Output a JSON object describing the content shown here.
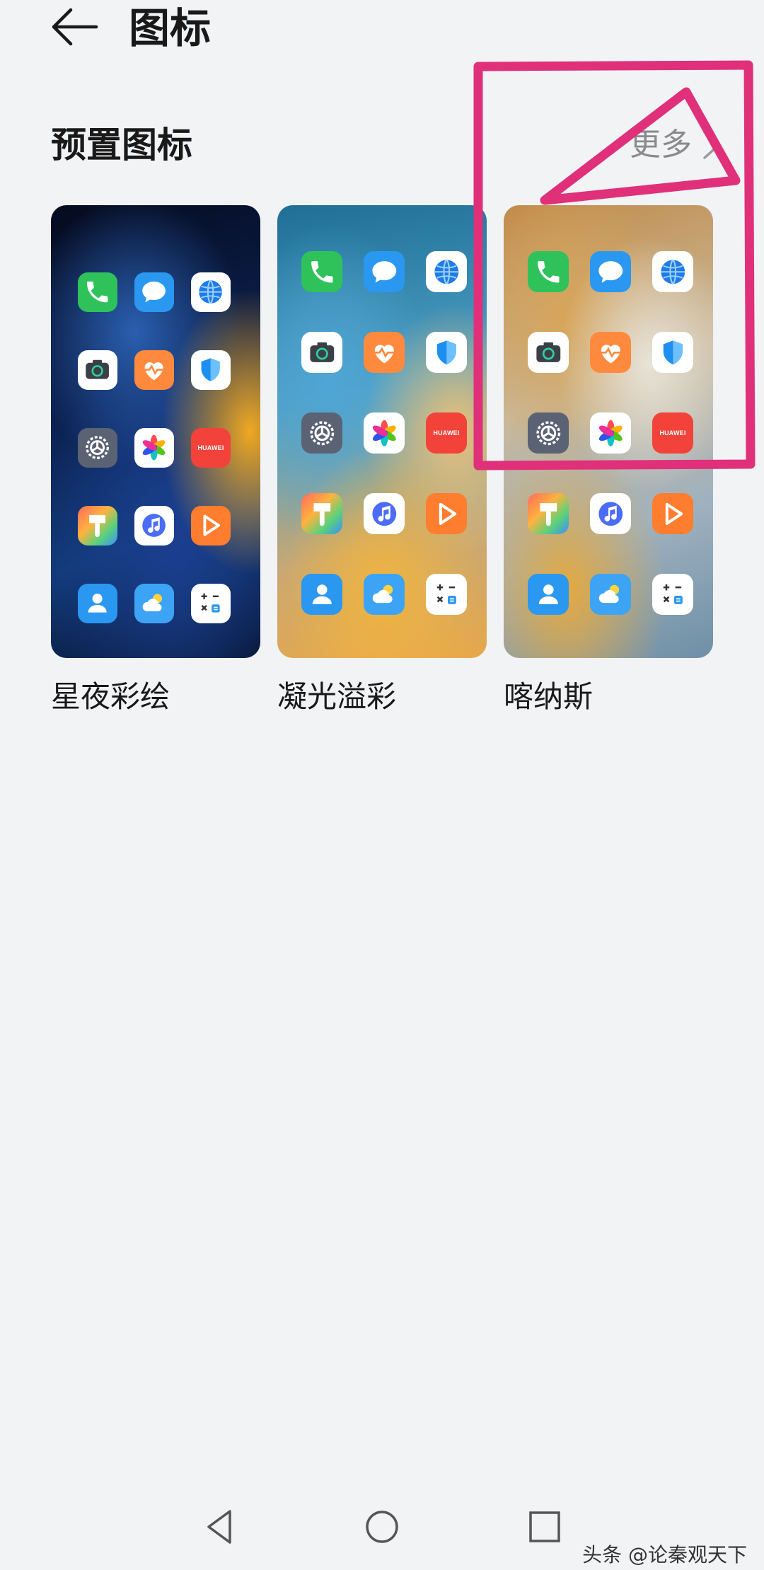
{
  "header": {
    "title": "图标",
    "back_icon": "arrow-left-icon"
  },
  "section": {
    "title": "预置图标",
    "more_label": "更多"
  },
  "cards": [
    {
      "label": "星夜彩绘"
    },
    {
      "label": "凝光溢彩"
    },
    {
      "label": "喀纳斯"
    }
  ],
  "app_icons": [
    "phone-icon",
    "messages-icon",
    "browser-icon",
    "camera-icon",
    "health-icon",
    "security-icon",
    "settings-icon",
    "gallery-icon",
    "appgallery-icon",
    "themes-icon",
    "music-icon",
    "video-icon",
    "contacts-icon",
    "weather-icon",
    "calculator-icon"
  ],
  "appgallery_text": "HUAWEI",
  "annotation_color": "#e0307a",
  "watermark": "头条 @论秦观天下",
  "nav": {
    "back_icon": "triangle-back-icon",
    "home_icon": "circle-home-icon",
    "recent_icon": "square-recent-icon"
  }
}
